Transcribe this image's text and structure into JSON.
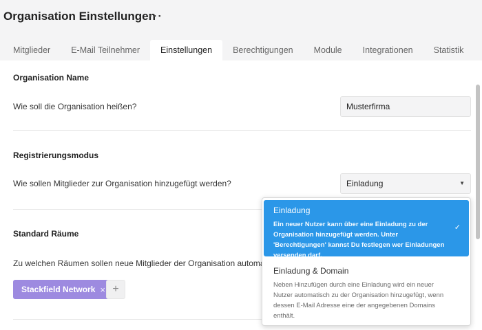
{
  "page": {
    "title": "Organisation Einstellungen",
    "more_icon": "more-horizontal-icon",
    "more_label": "···"
  },
  "tabs": [
    {
      "label": "Mitglieder"
    },
    {
      "label": "E-Mail Teilnehmer"
    },
    {
      "label": "Einstellungen",
      "active": true
    },
    {
      "label": "Berechtigungen"
    },
    {
      "label": "Module"
    },
    {
      "label": "Integrationen"
    },
    {
      "label": "Statistik"
    }
  ],
  "sections": {
    "name": {
      "title": "Organisation Name",
      "question": "Wie soll die Organisation heißen?",
      "value": "Musterfirma"
    },
    "registration": {
      "title": "Registrierungsmodus",
      "question": "Wie sollen Mitglieder zur Organisation hinzugefügt werden?",
      "selected": "Einladung",
      "caret": "▼"
    },
    "rooms": {
      "title": "Standard Räume",
      "question": "Zu welchen Räumen sollen neue Mitglieder der Organisation automatisch hinzugefügt werden?",
      "tag_label": "Stackfield Network",
      "tag_remove": "×",
      "add_label": "+"
    }
  },
  "dropdown": {
    "options": [
      {
        "title": "Einladung",
        "description": "Ein neuer Nutzer kann über eine Einladung zu der Organisation hinzugefügt werden. Unter 'Berechtigungen' kannst Du festlegen wer Einladungen versenden darf.",
        "selected": true,
        "check": "✓"
      },
      {
        "title": "Einladung & Domain",
        "description": "Neben Hinzufügen durch eine Einladung wird ein neuer Nutzer automatisch zu der Organisation hinzugefügt, wenn dessen E-Mail Adresse eine der angegebenen Domains enthält.",
        "selected": false
      }
    ]
  },
  "colors": {
    "accent": "#2b97e8",
    "tag": "#9d8ae0",
    "background": "#f4f4f5"
  }
}
